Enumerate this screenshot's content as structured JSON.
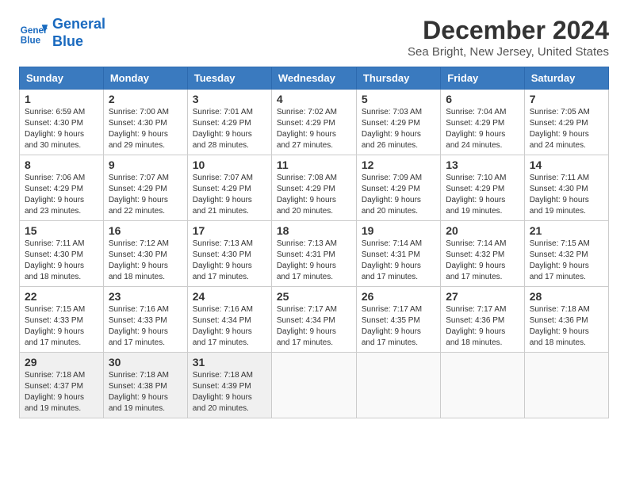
{
  "header": {
    "logo_line1": "General",
    "logo_line2": "Blue",
    "title": "December 2024",
    "subtitle": "Sea Bright, New Jersey, United States"
  },
  "weekdays": [
    "Sunday",
    "Monday",
    "Tuesday",
    "Wednesday",
    "Thursday",
    "Friday",
    "Saturday"
  ],
  "weeks": [
    [
      {
        "day": "1",
        "sunrise": "Sunrise: 6:59 AM",
        "sunset": "Sunset: 4:30 PM",
        "daylight": "Daylight: 9 hours and 30 minutes."
      },
      {
        "day": "2",
        "sunrise": "Sunrise: 7:00 AM",
        "sunset": "Sunset: 4:30 PM",
        "daylight": "Daylight: 9 hours and 29 minutes."
      },
      {
        "day": "3",
        "sunrise": "Sunrise: 7:01 AM",
        "sunset": "Sunset: 4:29 PM",
        "daylight": "Daylight: 9 hours and 28 minutes."
      },
      {
        "day": "4",
        "sunrise": "Sunrise: 7:02 AM",
        "sunset": "Sunset: 4:29 PM",
        "daylight": "Daylight: 9 hours and 27 minutes."
      },
      {
        "day": "5",
        "sunrise": "Sunrise: 7:03 AM",
        "sunset": "Sunset: 4:29 PM",
        "daylight": "Daylight: 9 hours and 26 minutes."
      },
      {
        "day": "6",
        "sunrise": "Sunrise: 7:04 AM",
        "sunset": "Sunset: 4:29 PM",
        "daylight": "Daylight: 9 hours and 24 minutes."
      },
      {
        "day": "7",
        "sunrise": "Sunrise: 7:05 AM",
        "sunset": "Sunset: 4:29 PM",
        "daylight": "Daylight: 9 hours and 24 minutes."
      }
    ],
    [
      {
        "day": "8",
        "sunrise": "Sunrise: 7:06 AM",
        "sunset": "Sunset: 4:29 PM",
        "daylight": "Daylight: 9 hours and 23 minutes."
      },
      {
        "day": "9",
        "sunrise": "Sunrise: 7:07 AM",
        "sunset": "Sunset: 4:29 PM",
        "daylight": "Daylight: 9 hours and 22 minutes."
      },
      {
        "day": "10",
        "sunrise": "Sunrise: 7:07 AM",
        "sunset": "Sunset: 4:29 PM",
        "daylight": "Daylight: 9 hours and 21 minutes."
      },
      {
        "day": "11",
        "sunrise": "Sunrise: 7:08 AM",
        "sunset": "Sunset: 4:29 PM",
        "daylight": "Daylight: 9 hours and 20 minutes."
      },
      {
        "day": "12",
        "sunrise": "Sunrise: 7:09 AM",
        "sunset": "Sunset: 4:29 PM",
        "daylight": "Daylight: 9 hours and 20 minutes."
      },
      {
        "day": "13",
        "sunrise": "Sunrise: 7:10 AM",
        "sunset": "Sunset: 4:29 PM",
        "daylight": "Daylight: 9 hours and 19 minutes."
      },
      {
        "day": "14",
        "sunrise": "Sunrise: 7:11 AM",
        "sunset": "Sunset: 4:30 PM",
        "daylight": "Daylight: 9 hours and 19 minutes."
      }
    ],
    [
      {
        "day": "15",
        "sunrise": "Sunrise: 7:11 AM",
        "sunset": "Sunset: 4:30 PM",
        "daylight": "Daylight: 9 hours and 18 minutes."
      },
      {
        "day": "16",
        "sunrise": "Sunrise: 7:12 AM",
        "sunset": "Sunset: 4:30 PM",
        "daylight": "Daylight: 9 hours and 18 minutes."
      },
      {
        "day": "17",
        "sunrise": "Sunrise: 7:13 AM",
        "sunset": "Sunset: 4:30 PM",
        "daylight": "Daylight: 9 hours and 17 minutes."
      },
      {
        "day": "18",
        "sunrise": "Sunrise: 7:13 AM",
        "sunset": "Sunset: 4:31 PM",
        "daylight": "Daylight: 9 hours and 17 minutes."
      },
      {
        "day": "19",
        "sunrise": "Sunrise: 7:14 AM",
        "sunset": "Sunset: 4:31 PM",
        "daylight": "Daylight: 9 hours and 17 minutes."
      },
      {
        "day": "20",
        "sunrise": "Sunrise: 7:14 AM",
        "sunset": "Sunset: 4:32 PM",
        "daylight": "Daylight: 9 hours and 17 minutes."
      },
      {
        "day": "21",
        "sunrise": "Sunrise: 7:15 AM",
        "sunset": "Sunset: 4:32 PM",
        "daylight": "Daylight: 9 hours and 17 minutes."
      }
    ],
    [
      {
        "day": "22",
        "sunrise": "Sunrise: 7:15 AM",
        "sunset": "Sunset: 4:33 PM",
        "daylight": "Daylight: 9 hours and 17 minutes."
      },
      {
        "day": "23",
        "sunrise": "Sunrise: 7:16 AM",
        "sunset": "Sunset: 4:33 PM",
        "daylight": "Daylight: 9 hours and 17 minutes."
      },
      {
        "day": "24",
        "sunrise": "Sunrise: 7:16 AM",
        "sunset": "Sunset: 4:34 PM",
        "daylight": "Daylight: 9 hours and 17 minutes."
      },
      {
        "day": "25",
        "sunrise": "Sunrise: 7:17 AM",
        "sunset": "Sunset: 4:34 PM",
        "daylight": "Daylight: 9 hours and 17 minutes."
      },
      {
        "day": "26",
        "sunrise": "Sunrise: 7:17 AM",
        "sunset": "Sunset: 4:35 PM",
        "daylight": "Daylight: 9 hours and 17 minutes."
      },
      {
        "day": "27",
        "sunrise": "Sunrise: 7:17 AM",
        "sunset": "Sunset: 4:36 PM",
        "daylight": "Daylight: 9 hours and 18 minutes."
      },
      {
        "day": "28",
        "sunrise": "Sunrise: 7:18 AM",
        "sunset": "Sunset: 4:36 PM",
        "daylight": "Daylight: 9 hours and 18 minutes."
      }
    ],
    [
      {
        "day": "29",
        "sunrise": "Sunrise: 7:18 AM",
        "sunset": "Sunset: 4:37 PM",
        "daylight": "Daylight: 9 hours and 19 minutes."
      },
      {
        "day": "30",
        "sunrise": "Sunrise: 7:18 AM",
        "sunset": "Sunset: 4:38 PM",
        "daylight": "Daylight: 9 hours and 19 minutes."
      },
      {
        "day": "31",
        "sunrise": "Sunrise: 7:18 AM",
        "sunset": "Sunset: 4:39 PM",
        "daylight": "Daylight: 9 hours and 20 minutes."
      },
      null,
      null,
      null,
      null
    ]
  ]
}
